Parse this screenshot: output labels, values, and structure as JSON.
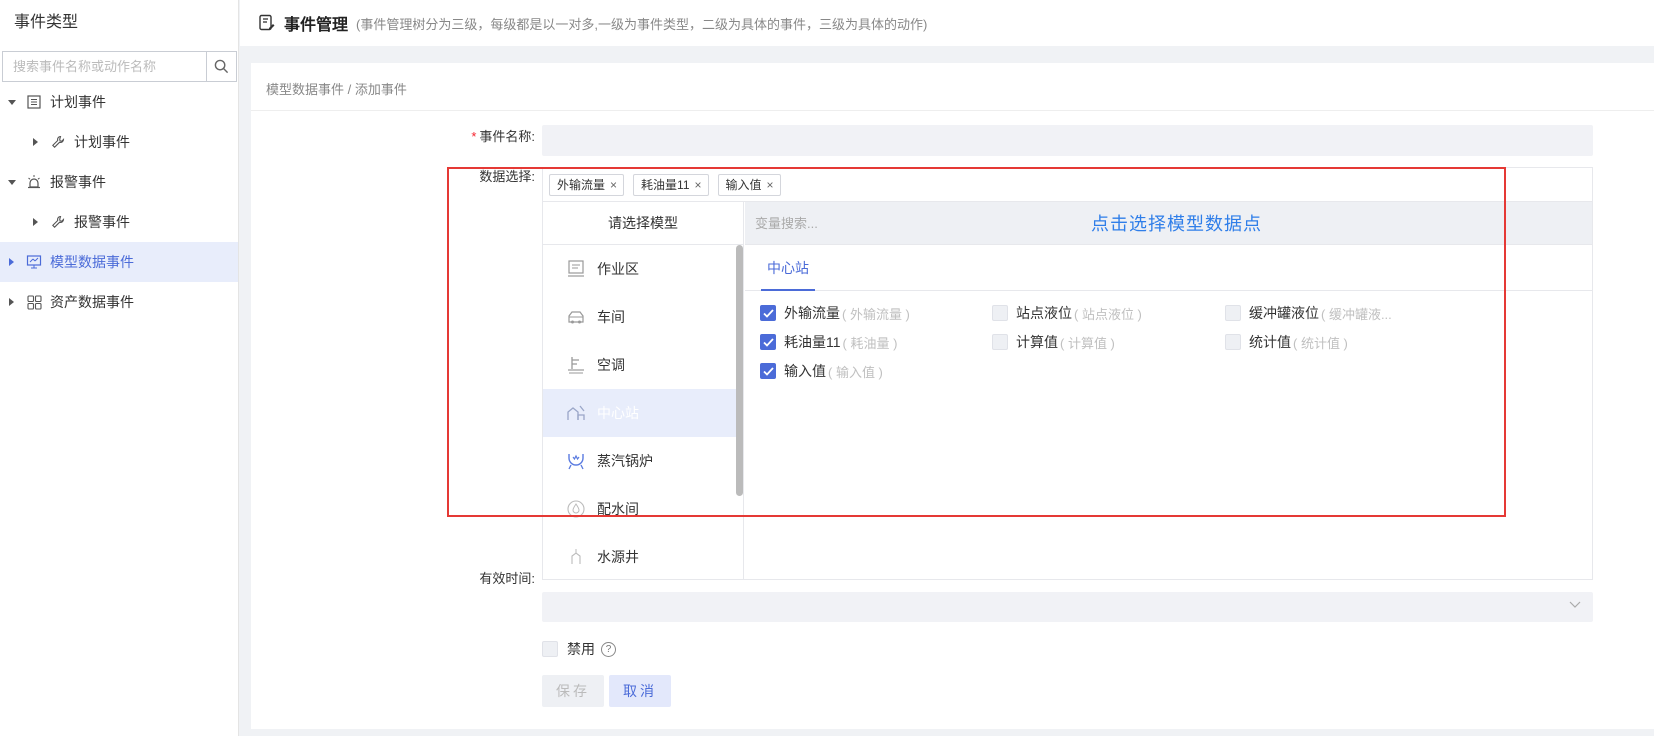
{
  "sidebar": {
    "title": "事件类型",
    "search_placeholder": "搜索事件名称或动作名称",
    "items": [
      {
        "label": "计划事件",
        "level": 1,
        "expanded": true
      },
      {
        "label": "计划事件",
        "level": 2
      },
      {
        "label": "报警事件",
        "level": 1,
        "expanded": true
      },
      {
        "label": "报警事件",
        "level": 2
      },
      {
        "label": "模型数据事件",
        "level": 1,
        "active": true
      },
      {
        "label": "资产数据事件",
        "level": 1
      }
    ]
  },
  "header": {
    "title": "事件管理",
    "description": "(事件管理树分为三级，每级都是以一对多,一级为事件类型，二级为具体的事件，三级为具体的动作)"
  },
  "breadcrumb": "模型数据事件 / 添加事件",
  "form": {
    "event_name_label": "事件名称:",
    "event_name_required": "*",
    "data_select_label": "数据选择:",
    "valid_time_label": "有效时间:",
    "disable_label": "禁用",
    "help_glyph": "?",
    "save_label": "保存",
    "cancel_label": "取消"
  },
  "tags": [
    {
      "label": "外输流量",
      "close": "×"
    },
    {
      "label": "耗油量11",
      "close": "×"
    },
    {
      "label": "输入值",
      "close": "×"
    }
  ],
  "model_list": {
    "header": "请选择模型",
    "items": [
      {
        "label": "作业区",
        "icon": "work-area-icon"
      },
      {
        "label": "车间",
        "icon": "workshop-icon"
      },
      {
        "label": "空调",
        "icon": "air-conditioner-icon"
      },
      {
        "label": "中心站",
        "icon": "central-station-icon",
        "active": true
      },
      {
        "label": "蒸汽锅炉",
        "icon": "steam-boiler-icon"
      },
      {
        "label": "配水间",
        "icon": "water-distribution-icon"
      },
      {
        "label": "水源井",
        "icon": "water-well-icon"
      }
    ]
  },
  "variable_search_placeholder": "变量搜索...",
  "hint": "点击选择模型数据点",
  "tab": "中心站",
  "options": [
    {
      "label": "外输流量",
      "sub": "( 外输流量 )",
      "checked": true
    },
    {
      "label": "站点液位",
      "sub": "( 站点液位 )",
      "checked": false
    },
    {
      "label": "缓冲罐液位",
      "sub": "( 缓冲罐液...",
      "checked": false
    },
    {
      "label": "耗油量11",
      "sub": "( 耗油量 )",
      "checked": true
    },
    {
      "label": "计算值",
      "sub": "( 计算值 )",
      "checked": false
    },
    {
      "label": "统计值",
      "sub": "( 统计值 )",
      "checked": false
    },
    {
      "label": "输入值",
      "sub": "( 输入值 )",
      "checked": true
    }
  ],
  "colors": {
    "primary": "#4b6bd8",
    "hint_blue": "#2f7ee9",
    "highlight_frame": "#e53935",
    "active_bg": "#e8edfb"
  }
}
